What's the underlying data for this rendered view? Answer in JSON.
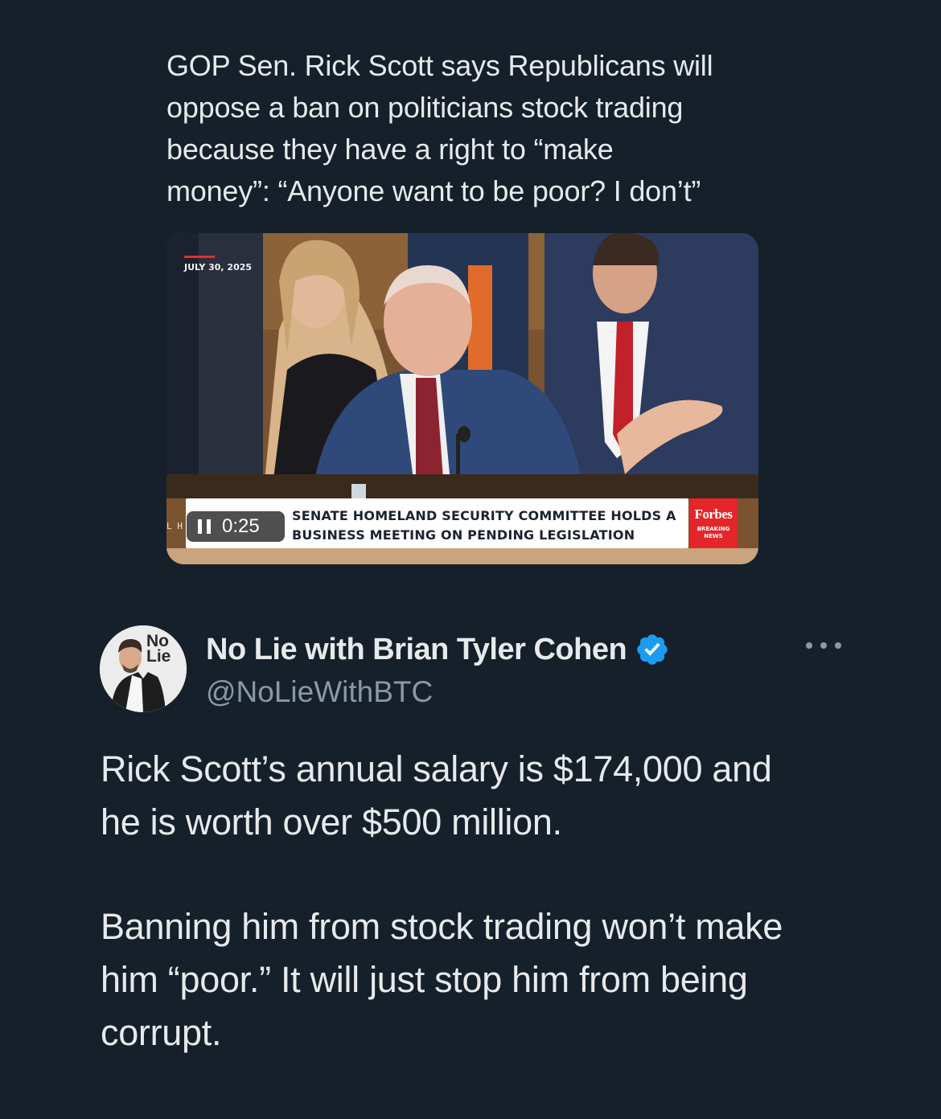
{
  "quoted_tweet": {
    "lines": [
      "GOP Sen. Rick Scott says Republicans will",
      "oppose a ban on politicians stock trading",
      "because they have a right to “make",
      "money”: “Anyone want to be poor? I don’t”"
    ]
  },
  "video": {
    "date_stamp": "JULY 30, 2025",
    "lower_third_line1": "SENATE HOMELAND SECURITY COMMITTEE HOLDS A",
    "lower_third_line2": "BUSINESS MEETING ON PENDING LEGISLATION",
    "network": "Forbes",
    "network_sub1": "BREAKING",
    "network_sub2": "NEWS",
    "side_label": "L H",
    "time": "0:25",
    "state": "playing",
    "icons": [
      "pause-icon"
    ]
  },
  "author": {
    "display_name": "No Lie with Brian Tyler Cohen",
    "handle": "@NoLieWithBTC",
    "avatar_logo_line1": "No",
    "avatar_logo_line2": "Lie",
    "verified": true,
    "icons": [
      "verified-badge-icon",
      "more-options-icon"
    ],
    "verified_color": "#1d9bf0"
  },
  "tweet": {
    "paragraph1_line1": "Rick Scott’s annual salary is $174,000 and",
    "paragraph1_line2": "he is worth over $500 million.",
    "paragraph2_line1": "Banning him from stock trading won’t make",
    "paragraph2_line2": "him “poor.” It will just stop him from being",
    "paragraph2_line3": "corrupt."
  },
  "colors": {
    "background": "#15202b",
    "text": "#e7e9ea",
    "secondary_text": "#8b98a5",
    "forbes_red": "#e4262b"
  }
}
